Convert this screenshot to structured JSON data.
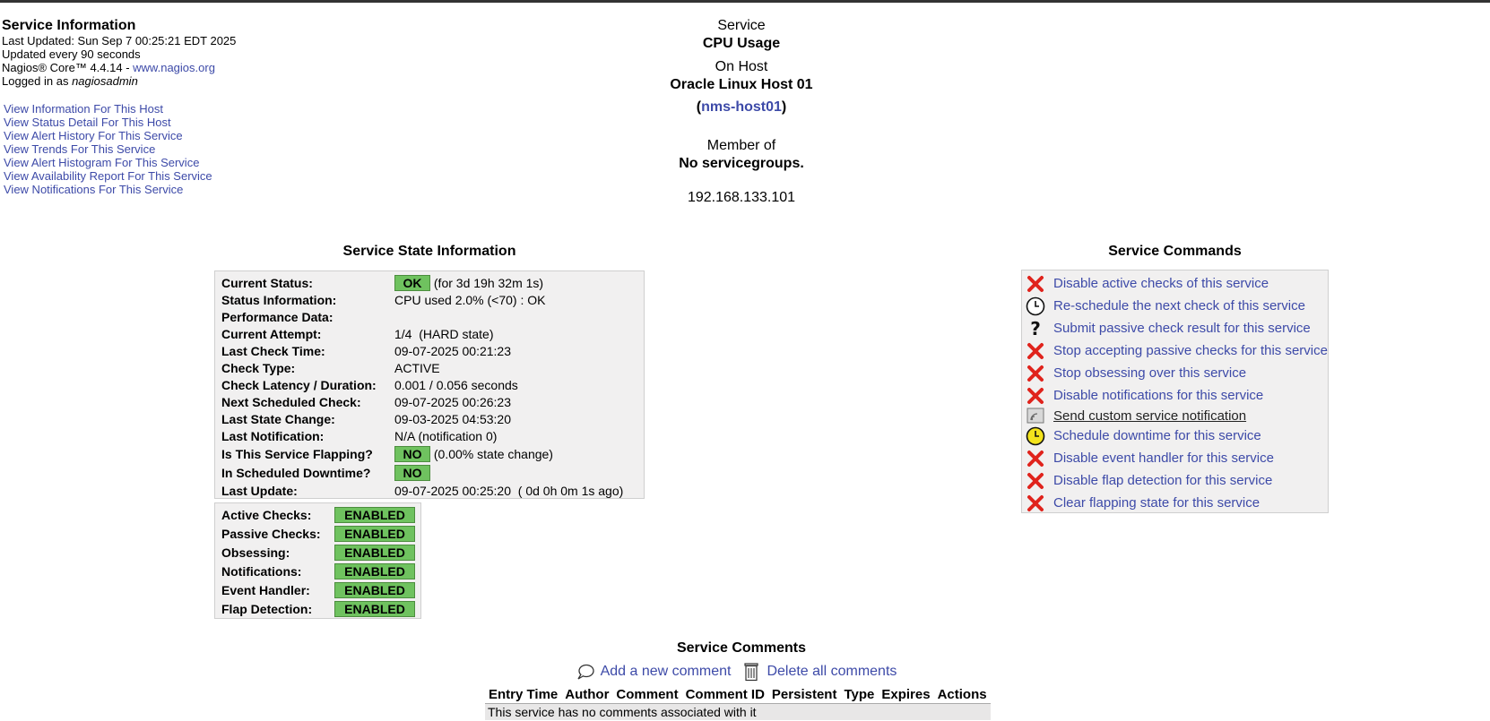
{
  "info": {
    "title": "Service Information",
    "last_updated": "Last Updated: Sun Sep 7 00:25:21 EDT 2025",
    "update_interval": "Updated every 90 seconds",
    "version_prefix": "Nagios® Core™ 4.4.14 - ",
    "version_link": "www.nagios.org",
    "logged_in_prefix": "Logged in as ",
    "logged_in_user": "nagiosadmin"
  },
  "links": [
    "View Information For This Host",
    "View Status Detail For This Host",
    "View Alert History For This Service",
    "View Trends For This Service",
    "View Alert Histogram For This Service",
    "View Availability Report For This Service",
    "View Notifications For This Service"
  ],
  "header": {
    "service_label": "Service",
    "service_name": "CPU Usage",
    "host_label": "On Host",
    "host_name": "Oracle Linux Host 01",
    "host_link": "nms-host01",
    "member_label": "Member of",
    "member_value": "No servicegroups.",
    "address": "192.168.133.101"
  },
  "state": {
    "title": "Service State Information",
    "current_status_label": "Current Status:",
    "current_status_badge": "OK",
    "current_status_duration": "(for 3d 19h 32m 1s)",
    "status_info_label": "Status Information:",
    "status_info": "CPU used 2.0% (<70) : OK",
    "perf_label": "Performance Data:",
    "perf_value": "",
    "attempt_label": "Current Attempt:",
    "attempt_value": "1/4  (HARD state)",
    "last_check_label": "Last Check Time:",
    "last_check_value": "09-07-2025 00:21:23",
    "check_type_label": "Check Type:",
    "check_type_value": "ACTIVE",
    "latency_label": "Check Latency / Duration:",
    "latency_value": "0.001 / 0.056 seconds",
    "next_check_label": "Next Scheduled Check:",
    "next_check_value": "09-07-2025 00:26:23",
    "last_change_label": "Last State Change:",
    "last_change_value": "09-03-2025 04:53:20",
    "last_notif_label": "Last Notification:",
    "last_notif_value": "N/A (notification 0)",
    "flapping_label": "Is This Service Flapping?",
    "flapping_badge": "NO",
    "flapping_pct": "(0.00% state change)",
    "downtime_label": "In Scheduled Downtime?",
    "downtime_badge": "NO",
    "last_update_label": "Last Update:",
    "last_update_value": "09-07-2025 00:25:20  ( 0d 0h 0m 1s ago)"
  },
  "enabled": {
    "active_label": "Active Checks:",
    "passive_label": "Passive Checks:",
    "obsessing_label": "Obsessing:",
    "notifications_label": "Notifications:",
    "event_handler_label": "Event Handler:",
    "flap_detection_label": "Flap Detection:",
    "badge": "ENABLED"
  },
  "commands": {
    "title": "Service Commands",
    "items": [
      {
        "label": "Disable active checks of this service",
        "icon": "red-x-icon"
      },
      {
        "label": "Re-schedule the next check of this service",
        "icon": "clock-icon"
      },
      {
        "label": "Submit passive check result for this service",
        "icon": "question-icon"
      },
      {
        "label": "Stop accepting passive checks for this service",
        "icon": "red-x-icon"
      },
      {
        "label": "Stop obsessing over this service",
        "icon": "red-x-icon"
      },
      {
        "label": "Disable notifications for this service",
        "icon": "red-x-icon"
      },
      {
        "label": "Send custom service notification",
        "icon": "notification-icon"
      },
      {
        "label": "Schedule downtime for this service",
        "icon": "yellow-clock-icon"
      },
      {
        "label": "Disable event handler for this service",
        "icon": "red-x-icon"
      },
      {
        "label": "Disable flap detection for this service",
        "icon": "red-x-icon"
      },
      {
        "label": "Clear flapping state for this service",
        "icon": "red-x-icon"
      }
    ]
  },
  "comments": {
    "title": "Service Comments",
    "add": "Add a new comment",
    "delete": "Delete all comments",
    "columns": [
      "Entry Time",
      "Author",
      "Comment",
      "Comment ID",
      "Persistent",
      "Type",
      "Expires",
      "Actions"
    ],
    "empty": "This service has no comments associated with it"
  },
  "colors": {
    "ok_green": "#6fc25f",
    "link_blue": "#3d4aa8",
    "x_red": "#e0231c"
  }
}
